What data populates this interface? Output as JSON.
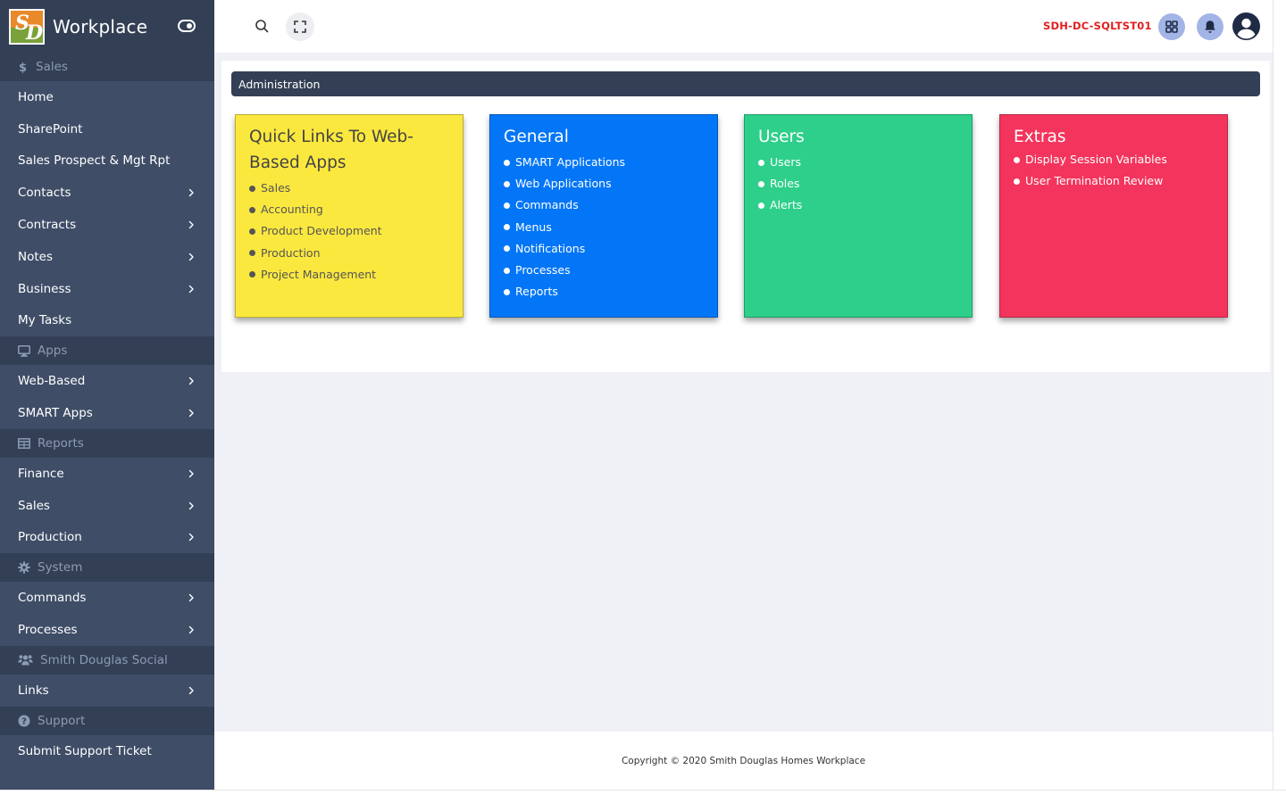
{
  "brand": {
    "name": "Workplace",
    "logo_text": "SD"
  },
  "sidebar": {
    "groups": [
      {
        "caption": "Sales",
        "icon": "dollar-icon",
        "items": [
          {
            "label": "Home",
            "chevron": false
          },
          {
            "label": "SharePoint",
            "chevron": false
          },
          {
            "label": "Sales Prospect & Mgt Rpt",
            "chevron": false
          },
          {
            "label": "Contacts",
            "chevron": true
          },
          {
            "label": "Contracts",
            "chevron": true
          },
          {
            "label": "Notes",
            "chevron": true
          },
          {
            "label": "Business",
            "chevron": true
          },
          {
            "label": "My Tasks",
            "chevron": false
          }
        ]
      },
      {
        "caption": "Apps",
        "icon": "monitor-icon",
        "items": [
          {
            "label": "Web-Based",
            "chevron": true
          },
          {
            "label": "SMART Apps",
            "chevron": true
          }
        ]
      },
      {
        "caption": "Reports",
        "icon": "table-icon",
        "items": [
          {
            "label": "Finance",
            "chevron": true
          },
          {
            "label": "Sales",
            "chevron": true
          },
          {
            "label": "Production",
            "chevron": true
          }
        ]
      },
      {
        "caption": "System",
        "icon": "gear-icon",
        "items": [
          {
            "label": "Commands",
            "chevron": true
          },
          {
            "label": "Processes",
            "chevron": true
          }
        ]
      },
      {
        "caption": "Smith Douglas Social",
        "icon": "users-icon",
        "items": [
          {
            "label": "Links",
            "chevron": true
          }
        ]
      },
      {
        "caption": "Support",
        "icon": "question-icon",
        "items": [
          {
            "label": "Submit Support Ticket",
            "chevron": false
          }
        ]
      }
    ]
  },
  "header": {
    "server": "SDH-DC-SQLTST01"
  },
  "main": {
    "section_title": "Administration",
    "cards": [
      {
        "title": "Quick Links To Web-Based Apps",
        "items": [
          "Sales",
          "Accounting",
          "Product Development",
          "Production",
          "Project Management"
        ]
      },
      {
        "title": "General",
        "items": [
          "SMART Applications",
          "Web Applications",
          "Commands",
          "Menus",
          "Notifications",
          "Processes",
          "Reports"
        ]
      },
      {
        "title": "Users",
        "items": [
          "Users",
          "Roles",
          "Alerts"
        ]
      },
      {
        "title": "Extras",
        "items": [
          "Display Session Variables",
          "User Termination Review"
        ]
      }
    ]
  },
  "footer": {
    "copyright": "Copyright © 2020 Smith Douglas Homes Workplace"
  }
}
